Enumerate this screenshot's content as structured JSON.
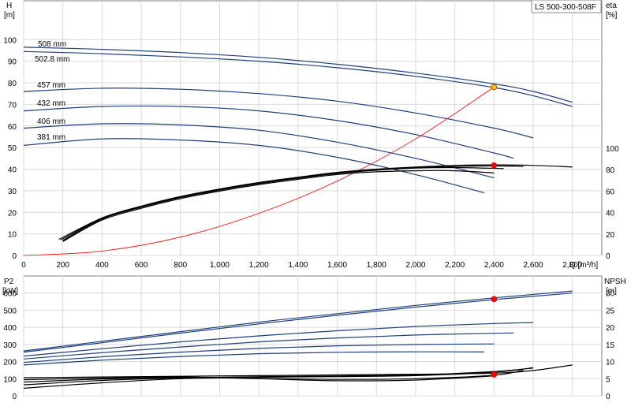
{
  "title": "LS 500-300-508F",
  "chart_data": [
    {
      "type": "line",
      "xlabel": "Q [m³/h]",
      "xlim": [
        0,
        2950
      ],
      "xticks": [
        0,
        200,
        400,
        600,
        800,
        1000,
        1200,
        1400,
        1600,
        1800,
        2000,
        2200,
        2400,
        2600,
        2800
      ],
      "xtick_labels": [
        "0",
        "200",
        "400",
        "600",
        "800",
        "1,000",
        "1,200",
        "1,400",
        "1,600",
        "1,800",
        "2,000",
        "2,200",
        "2,400",
        "2,600",
        "2,800"
      ],
      "ylabel_left": [
        "H",
        "[m]"
      ],
      "ylim_left": [
        0,
        118
      ],
      "yticks_left": [
        0,
        10,
        20,
        30,
        40,
        50,
        60,
        70,
        80,
        90,
        100
      ],
      "ylabel_right": [
        "eta",
        "[%]"
      ],
      "ylim_right": [
        0,
        100
      ],
      "yticks_right": [
        0,
        20,
        40,
        60,
        80,
        100
      ],
      "grid": true,
      "series": [
        {
          "name": "508 mm",
          "axis": "H",
          "color": "#1f3f7a",
          "x": [
            0,
            400,
            800,
            1200,
            1600,
            2000,
            2400,
            2600,
            2800
          ],
          "y": [
            96.5,
            95.5,
            94,
            91.8,
            88.6,
            84.5,
            79.5,
            76,
            71
          ]
        },
        {
          "name": "502.8 mm",
          "axis": "H",
          "color": "#1f3f7a",
          "x": [
            0,
            400,
            800,
            1200,
            1600,
            2000,
            2400,
            2600,
            2800
          ],
          "y": [
            94.5,
            93.5,
            92,
            90,
            87,
            83,
            77.8,
            74,
            69
          ]
        },
        {
          "name": "457 mm",
          "axis": "H",
          "color": "#1f3f7a",
          "x": [
            0,
            400,
            800,
            1200,
            1600,
            2000,
            2400,
            2600
          ],
          "y": [
            76,
            77.5,
            77,
            75,
            71.5,
            66,
            59,
            54.5
          ]
        },
        {
          "name": "432 mm",
          "axis": "H",
          "color": "#1f3f7a",
          "x": [
            0,
            400,
            800,
            1200,
            1600,
            2000,
            2400,
            2500
          ],
          "y": [
            67,
            69,
            69,
            67,
            62.5,
            56,
            47.5,
            45
          ]
        },
        {
          "name": "406 mm",
          "axis": "H",
          "color": "#1f3f7a",
          "x": [
            0,
            400,
            800,
            1200,
            1600,
            2000,
            2400
          ],
          "y": [
            59,
            61,
            60.5,
            58,
            52.5,
            45,
            36
          ]
        },
        {
          "name": "381 mm",
          "axis": "H",
          "color": "#1f3f7a",
          "x": [
            0,
            400,
            800,
            1200,
            1600,
            2000,
            2350
          ],
          "y": [
            51,
            54,
            53.5,
            51,
            45.5,
            37.5,
            29
          ]
        },
        {
          "axis": "H",
          "color": "#ff0000",
          "x": [
            0,
            400,
            800,
            1200,
            1600,
            2000,
            2400
          ],
          "y": [
            0,
            2,
            8.5,
            19.5,
            34.5,
            54,
            78
          ]
        },
        {
          "axis": "eta",
          "color": "#000000",
          "x": [
            180,
            400,
            600,
            800,
            1000,
            1200,
            1400,
            1600,
            1800,
            2000,
            2200,
            2400,
            2600,
            2800
          ],
          "y": [
            15,
            35,
            46,
            55,
            62,
            68,
            73,
            77.5,
            80.5,
            82.5,
            84,
            84.5,
            84,
            82.5
          ]
        },
        {
          "axis": "eta",
          "color": "#000000",
          "x": [
            200,
            400,
            600,
            800,
            1000,
            1200,
            1400,
            1600,
            1800,
            2000,
            2200,
            2400
          ],
          "y": [
            13,
            33,
            44,
            53,
            60,
            66,
            71,
            75.5,
            78,
            79,
            79,
            77
          ]
        },
        {
          "axis": "eta",
          "color": "#000000",
          "x": [
            200,
            400,
            600,
            800,
            1000,
            1200,
            1400,
            1600,
            1800,
            2000,
            2200,
            2450
          ],
          "y": [
            14,
            34,
            45,
            54,
            61,
            67,
            72,
            76.5,
            79.5,
            81.5,
            82,
            81
          ]
        },
        {
          "axis": "eta",
          "color": "#000000",
          "x": [
            190,
            400,
            600,
            800,
            1000,
            1200,
            1400,
            1600,
            1800,
            2000,
            2200,
            2400,
            2550
          ],
          "y": [
            14.5,
            34.5,
            45.5,
            54.5,
            61.5,
            67.5,
            72.5,
            77,
            80,
            82,
            83,
            83.5,
            83
          ]
        }
      ],
      "points": [
        {
          "axis": "H",
          "x": 2400,
          "y": 78,
          "color": "#ffc000"
        },
        {
          "axis": "eta",
          "x": 2400,
          "y": 84,
          "color": "#ff0000"
        }
      ]
    },
    {
      "type": "line",
      "xlim": [
        0,
        2950
      ],
      "ylabel_left": [
        "P2",
        "[kW]"
      ],
      "ylim_left": [
        0,
        700
      ],
      "yticks_left": [
        0,
        100,
        200,
        300,
        400,
        500,
        600
      ],
      "ylabel_right": [
        "NPSH",
        "[m]"
      ],
      "ylim_right": [
        0,
        35
      ],
      "yticks_right": [
        0,
        5,
        10,
        15,
        20,
        25,
        30
      ],
      "grid": true,
      "series": [
        {
          "axis": "P2",
          "color": "#1f3f7a",
          "x": [
            0,
            400,
            800,
            1200,
            1600,
            2000,
            2400,
            2800
          ],
          "y": [
            262,
            318,
            375,
            430,
            480,
            528,
            572,
            612
          ]
        },
        {
          "axis": "P2",
          "color": "#1f3f7a",
          "x": [
            0,
            400,
            800,
            1200,
            1600,
            2000,
            2400,
            2800
          ],
          "y": [
            255,
            310,
            366,
            420,
            470,
            518,
            562,
            600
          ]
        },
        {
          "axis": "P2",
          "color": "#1f3f7a",
          "x": [
            0,
            400,
            800,
            1200,
            1600,
            2000,
            2400,
            2600
          ],
          "y": [
            232,
            275,
            315,
            350,
            380,
            405,
            422,
            428
          ]
        },
        {
          "axis": "P2",
          "color": "#1f3f7a",
          "x": [
            0,
            400,
            800,
            1200,
            1600,
            2000,
            2400,
            2500
          ],
          "y": [
            215,
            252,
            285,
            315,
            338,
            355,
            365,
            367
          ]
        },
        {
          "axis": "P2",
          "color": "#1f3f7a",
          "x": [
            0,
            400,
            800,
            1200,
            1600,
            2000,
            2400
          ],
          "y": [
            195,
            228,
            255,
            277,
            292,
            300,
            303
          ]
        },
        {
          "axis": "P2",
          "color": "#1f3f7a",
          "x": [
            0,
            400,
            800,
            1200,
            1600,
            2000,
            2350
          ],
          "y": [
            180,
            208,
            230,
            246,
            254,
            257,
            256
          ]
        },
        {
          "axis": "NPSH",
          "color": "#000000",
          "x": [
            0,
            400,
            800,
            1200,
            1600,
            2000,
            2400,
            2600,
            2800
          ],
          "y": [
            5.3,
            5.5,
            5.7,
            5.9,
            6.1,
            6.3,
            6.6,
            7.4,
            9
          ]
        },
        {
          "axis": "NPSH",
          "color": "#000000",
          "x": [
            0,
            400,
            800,
            1200,
            1600,
            2000,
            2400,
            2600
          ],
          "y": [
            2.2,
            3.8,
            5,
            5.4,
            5.6,
            5.9,
            6.9,
            8.2
          ]
        },
        {
          "axis": "NPSH",
          "color": "#000000",
          "x": [
            0,
            400,
            800,
            1200,
            1600,
            2000,
            2400,
            2600
          ],
          "y": [
            3.2,
            4.5,
            5.2,
            5.6,
            5.8,
            6.1,
            7.1,
            8.1
          ]
        },
        {
          "axis": "NPSH",
          "color": "#000000",
          "x": [
            0,
            400,
            800,
            1200,
            1600,
            2000,
            2400,
            2550
          ],
          "y": [
            4,
            4.9,
            5.4,
            5.1,
            4.8,
            5,
            6,
            7.5
          ]
        },
        {
          "axis": "NPSH",
          "color": "#000000",
          "x": [
            0,
            400,
            800,
            1200,
            1600,
            2000,
            2400
          ],
          "y": [
            4.7,
            5.2,
            5.5,
            5,
            4.4,
            4.6,
            5.8
          ]
        }
      ],
      "points": [
        {
          "axis": "P2",
          "x": 2400,
          "y": 565,
          "color": "#ff0000"
        },
        {
          "axis": "NPSH",
          "x": 2400,
          "y": 6.2,
          "color": "#ff0000"
        }
      ]
    }
  ]
}
